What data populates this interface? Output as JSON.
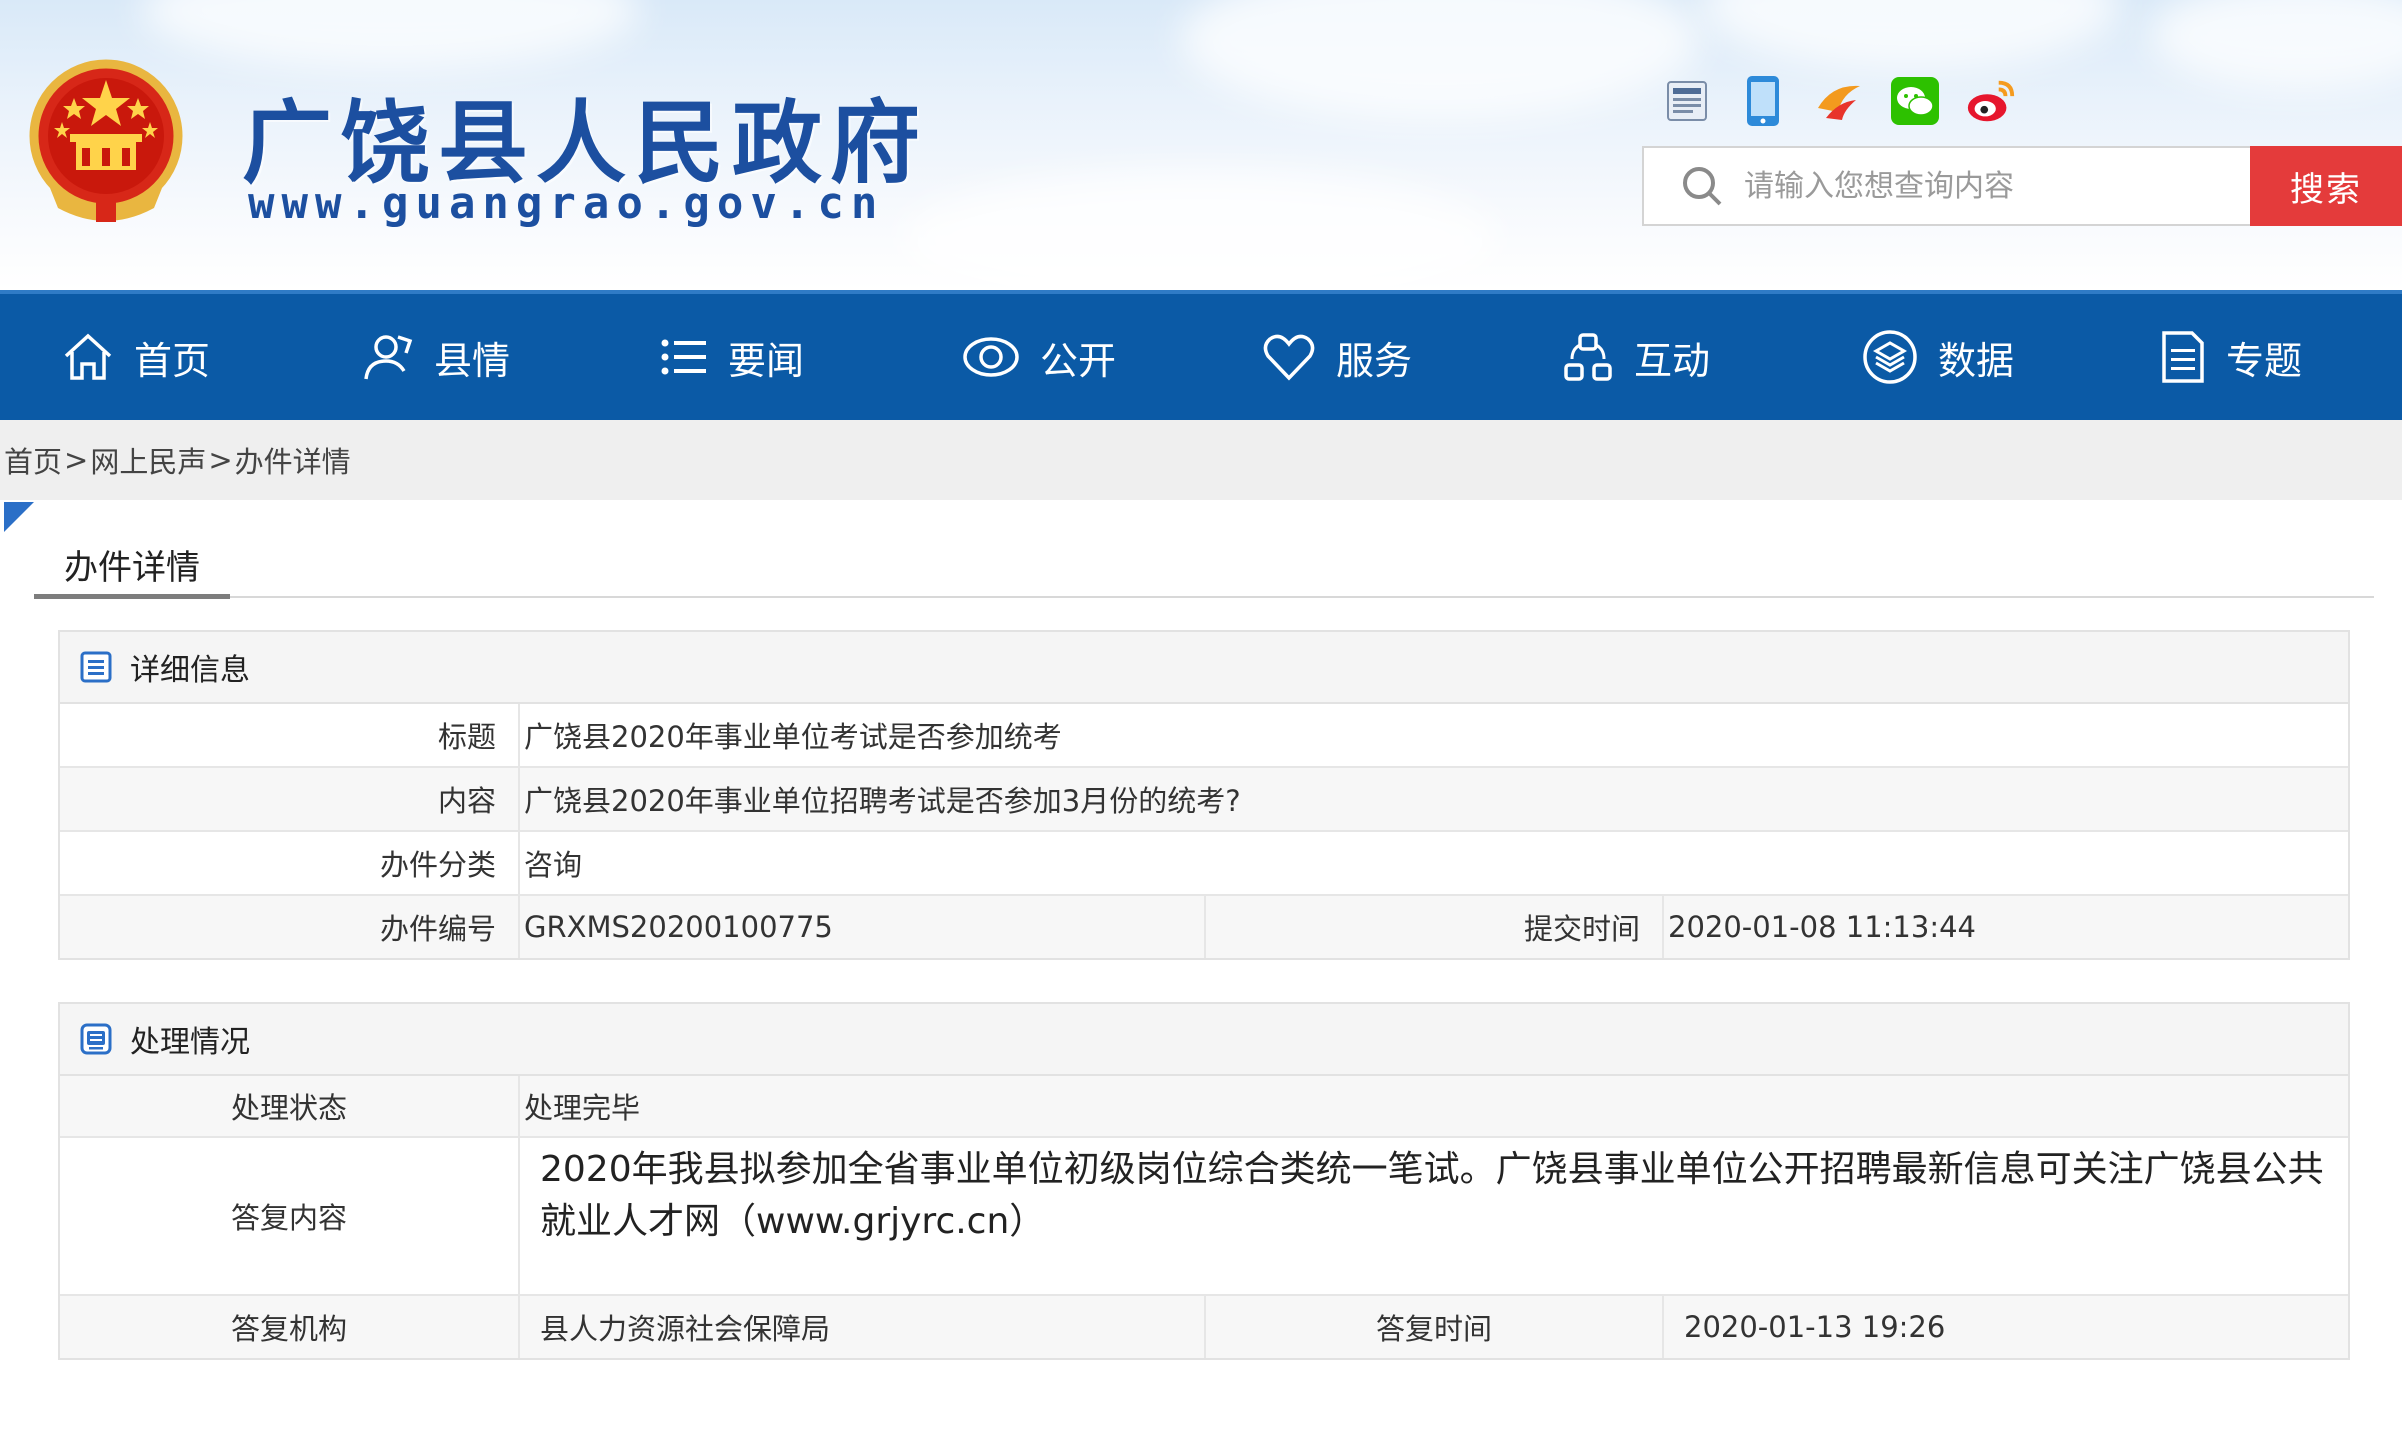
{
  "header": {
    "site_title": "广饶县人民政府",
    "site_url": "www.guangrao.gov.cn",
    "social_icons": [
      "government-service-icon",
      "mobile-icon",
      "sina-icon",
      "wechat-icon",
      "weibo-icon"
    ],
    "search": {
      "placeholder": "请输入您想查询内容",
      "button_label": "搜索"
    }
  },
  "nav": {
    "items": [
      {
        "label": "首页",
        "icon": "home-icon"
      },
      {
        "label": "县情",
        "icon": "county-icon"
      },
      {
        "label": "要闻",
        "icon": "list-icon"
      },
      {
        "label": "公开",
        "icon": "eye-icon"
      },
      {
        "label": "服务",
        "icon": "heart-icon"
      },
      {
        "label": "互动",
        "icon": "interact-icon"
      },
      {
        "label": "数据",
        "icon": "data-icon"
      },
      {
        "label": "专题",
        "icon": "document-icon"
      }
    ]
  },
  "breadcrumb": {
    "items": [
      "首页",
      "网上民声",
      "办件详情"
    ],
    "separator": ">"
  },
  "page_tab": "办件详情",
  "details": {
    "heading": "详细信息",
    "title_label": "标题",
    "title_value": "广饶县2020年事业单位考试是否参加统考",
    "content_label": "内容",
    "content_value": "广饶县2020年事业单位招聘考试是否参加3月份的统考?",
    "category_label": "办件分类",
    "category_value": "咨询",
    "number_label": "办件编号",
    "number_value": "GRXMS20200100775",
    "submit_time_label": "提交时间",
    "submit_time_value": "2020-01-08 11:13:44"
  },
  "processing": {
    "heading": "处理情况",
    "status_label": "处理状态",
    "status_value": "处理完毕",
    "reply_label": "答复内容",
    "reply_value": "2020年我县拟参加全省事业单位初级岗位综合类统一笔试。广饶县事业单位公开招聘最新信息可关注广饶县公共就业人才网（www.grjyrc.cn）",
    "org_label": "答复机构",
    "org_value": "县人力资源社会保障局",
    "reply_time_label": "答复时间",
    "reply_time_value": "2020-01-13 19:26"
  },
  "colors": {
    "nav_blue": "#0b5aa6",
    "search_red": "#e43b3b",
    "title_blue": "#1c4fa0"
  }
}
